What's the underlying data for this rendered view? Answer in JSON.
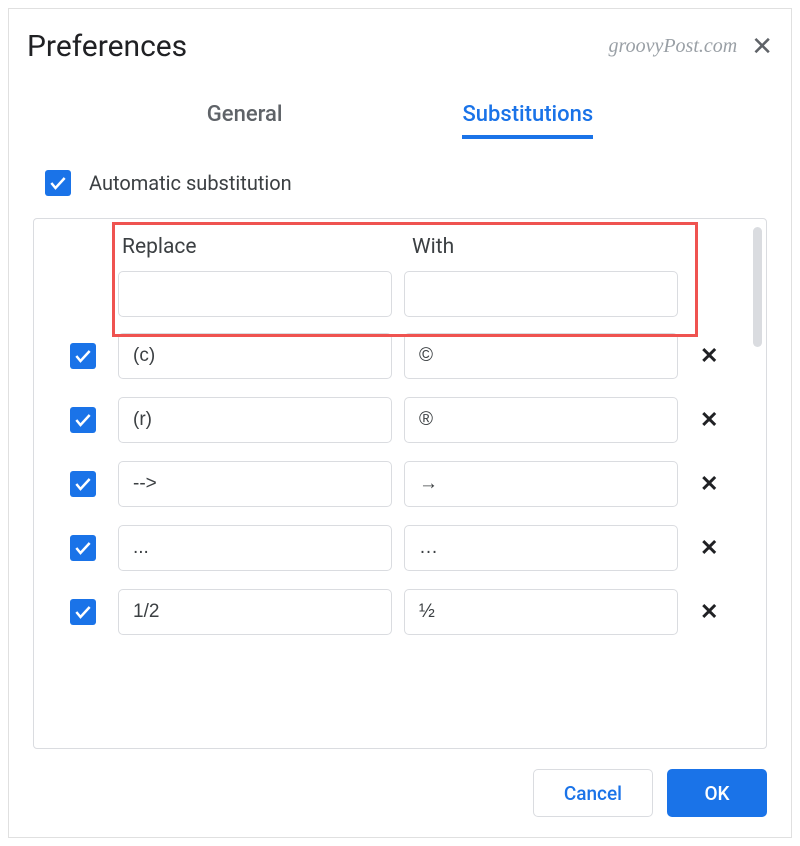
{
  "dialog": {
    "title": "Preferences",
    "watermark": "groovyPost.com"
  },
  "tabs": {
    "general": "General",
    "substitutions": "Substitutions"
  },
  "autoSub": {
    "label": "Automatic substitution",
    "checked": true
  },
  "columns": {
    "replace": "Replace",
    "with": "With"
  },
  "newRow": {
    "replace": "",
    "with": ""
  },
  "rows": [
    {
      "checked": true,
      "replace": "(c)",
      "with": "©"
    },
    {
      "checked": true,
      "replace": "(r)",
      "with": "®"
    },
    {
      "checked": true,
      "replace": "-->",
      "with": "→"
    },
    {
      "checked": true,
      "replace": "...",
      "with": "…"
    },
    {
      "checked": true,
      "replace": "1/2",
      "with": "½"
    }
  ],
  "buttons": {
    "cancel": "Cancel",
    "ok": "OK"
  }
}
